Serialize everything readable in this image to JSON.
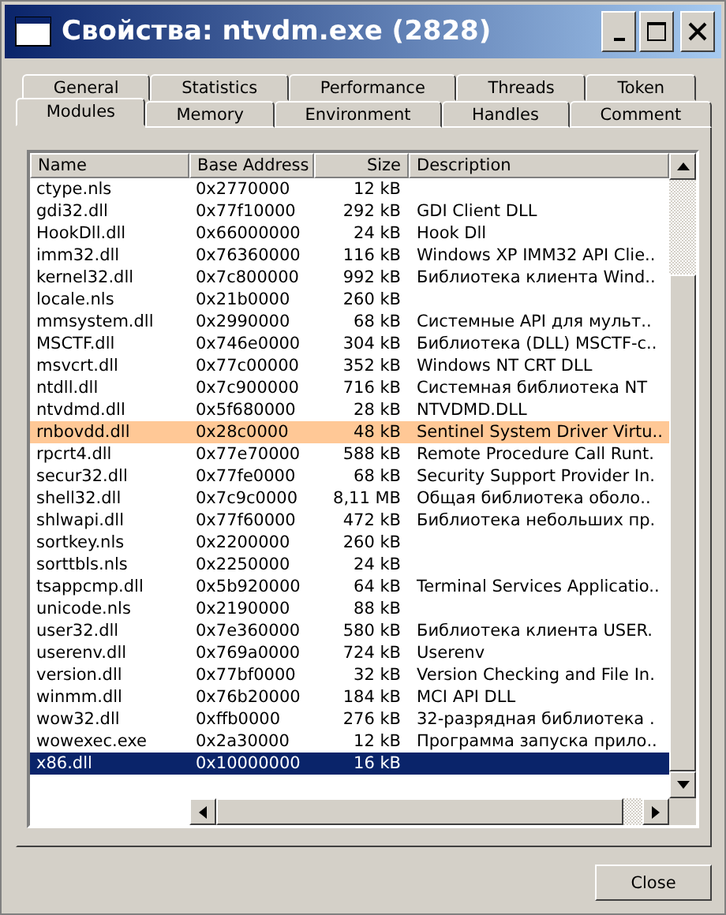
{
  "window": {
    "title": "Свойства: ntvdm.exe (2828)"
  },
  "tab_rows": [
    [
      {
        "label": "General",
        "selected": false
      },
      {
        "label": "Statistics",
        "selected": false
      },
      {
        "label": "Performance",
        "selected": false
      },
      {
        "label": "Threads",
        "selected": false
      },
      {
        "label": "Token",
        "selected": false
      }
    ],
    [
      {
        "label": "Modules",
        "selected": true
      },
      {
        "label": "Memory",
        "selected": false
      },
      {
        "label": "Environment",
        "selected": false
      },
      {
        "label": "Handles",
        "selected": false
      },
      {
        "label": "Comment",
        "selected": false
      }
    ]
  ],
  "table": {
    "columns": [
      "Name",
      "Base Address",
      "Size",
      "Description"
    ],
    "rows": [
      {
        "cells": [
          "ctype.nls",
          "0x2770000",
          "12 kB",
          ""
        ],
        "highlighted": false,
        "selected": false
      },
      {
        "cells": [
          "gdi32.dll",
          "0x77f10000",
          "292 kB",
          "GDI Client DLL"
        ],
        "highlighted": false,
        "selected": false
      },
      {
        "cells": [
          "HookDll.dll",
          "0x66000000",
          "24 kB",
          "Hook Dll"
        ],
        "highlighted": false,
        "selected": false
      },
      {
        "cells": [
          "imm32.dll",
          "0x76360000",
          "116 kB",
          "Windows XP IMM32 API Clie.."
        ],
        "highlighted": false,
        "selected": false
      },
      {
        "cells": [
          "kernel32.dll",
          "0x7c800000",
          "992 kB",
          "Библиотека клиента Wind.."
        ],
        "highlighted": false,
        "selected": false
      },
      {
        "cells": [
          "locale.nls",
          "0x21b0000",
          "260 kB",
          ""
        ],
        "highlighted": false,
        "selected": false
      },
      {
        "cells": [
          "mmsystem.dll",
          "0x2990000",
          "68 kB",
          "Системные API для мульт.."
        ],
        "highlighted": false,
        "selected": false
      },
      {
        "cells": [
          "MSCTF.dll",
          "0x746e0000",
          "304 kB",
          "Библиотека (DLL) MSCTF-c.."
        ],
        "highlighted": false,
        "selected": false
      },
      {
        "cells": [
          "msvcrt.dll",
          "0x77c00000",
          "352 kB",
          "Windows NT CRT DLL"
        ],
        "highlighted": false,
        "selected": false
      },
      {
        "cells": [
          "ntdll.dll",
          "0x7c900000",
          "716 kB",
          "Системная библиотека NT"
        ],
        "highlighted": false,
        "selected": false
      },
      {
        "cells": [
          "ntvdmd.dll",
          "0x5f680000",
          "28 kB",
          "NTVDMD.DLL"
        ],
        "highlighted": false,
        "selected": false
      },
      {
        "cells": [
          "rnbovdd.dll",
          "0x28c0000",
          "48 kB",
          "Sentinel System Driver Virtu.."
        ],
        "highlighted": true,
        "selected": false
      },
      {
        "cells": [
          "rpcrt4.dll",
          "0x77e70000",
          "588 kB",
          "Remote Procedure Call Runt."
        ],
        "highlighted": false,
        "selected": false
      },
      {
        "cells": [
          "secur32.dll",
          "0x77fe0000",
          "68 kB",
          "Security Support Provider In."
        ],
        "highlighted": false,
        "selected": false
      },
      {
        "cells": [
          "shell32.dll",
          "0x7c9c0000",
          "8,11 MB",
          "Общая библиотека оболо.."
        ],
        "highlighted": false,
        "selected": false
      },
      {
        "cells": [
          "shlwapi.dll",
          "0x77f60000",
          "472 kB",
          "Библиотека небольших пр."
        ],
        "highlighted": false,
        "selected": false
      },
      {
        "cells": [
          "sortkey.nls",
          "0x2200000",
          "260 kB",
          ""
        ],
        "highlighted": false,
        "selected": false
      },
      {
        "cells": [
          "sorttbls.nls",
          "0x2250000",
          "24 kB",
          ""
        ],
        "highlighted": false,
        "selected": false
      },
      {
        "cells": [
          "tsappcmp.dll",
          "0x5b920000",
          "64 kB",
          "Terminal Services Applicatio.."
        ],
        "highlighted": false,
        "selected": false
      },
      {
        "cells": [
          "unicode.nls",
          "0x2190000",
          "88 kB",
          ""
        ],
        "highlighted": false,
        "selected": false
      },
      {
        "cells": [
          "user32.dll",
          "0x7e360000",
          "580 kB",
          "Библиотека клиента USER."
        ],
        "highlighted": false,
        "selected": false
      },
      {
        "cells": [
          "userenv.dll",
          "0x769a0000",
          "724 kB",
          "Userenv"
        ],
        "highlighted": false,
        "selected": false
      },
      {
        "cells": [
          "version.dll",
          "0x77bf0000",
          "32 kB",
          "Version Checking and File In."
        ],
        "highlighted": false,
        "selected": false
      },
      {
        "cells": [
          "winmm.dll",
          "0x76b20000",
          "184 kB",
          "MCI API DLL"
        ],
        "highlighted": false,
        "selected": false
      },
      {
        "cells": [
          "wow32.dll",
          "0xffb0000",
          "276 kB",
          "32-разрядная библиотека ."
        ],
        "highlighted": false,
        "selected": false
      },
      {
        "cells": [
          "wowexec.exe",
          "0x2a30000",
          "12 kB",
          "Программа запуска прило.."
        ],
        "highlighted": false,
        "selected": false
      },
      {
        "cells": [
          "x86.dll",
          "0x10000000",
          "16 kB",
          ""
        ],
        "highlighted": false,
        "selected": true
      }
    ]
  },
  "buttons": [
    "Close"
  ]
}
